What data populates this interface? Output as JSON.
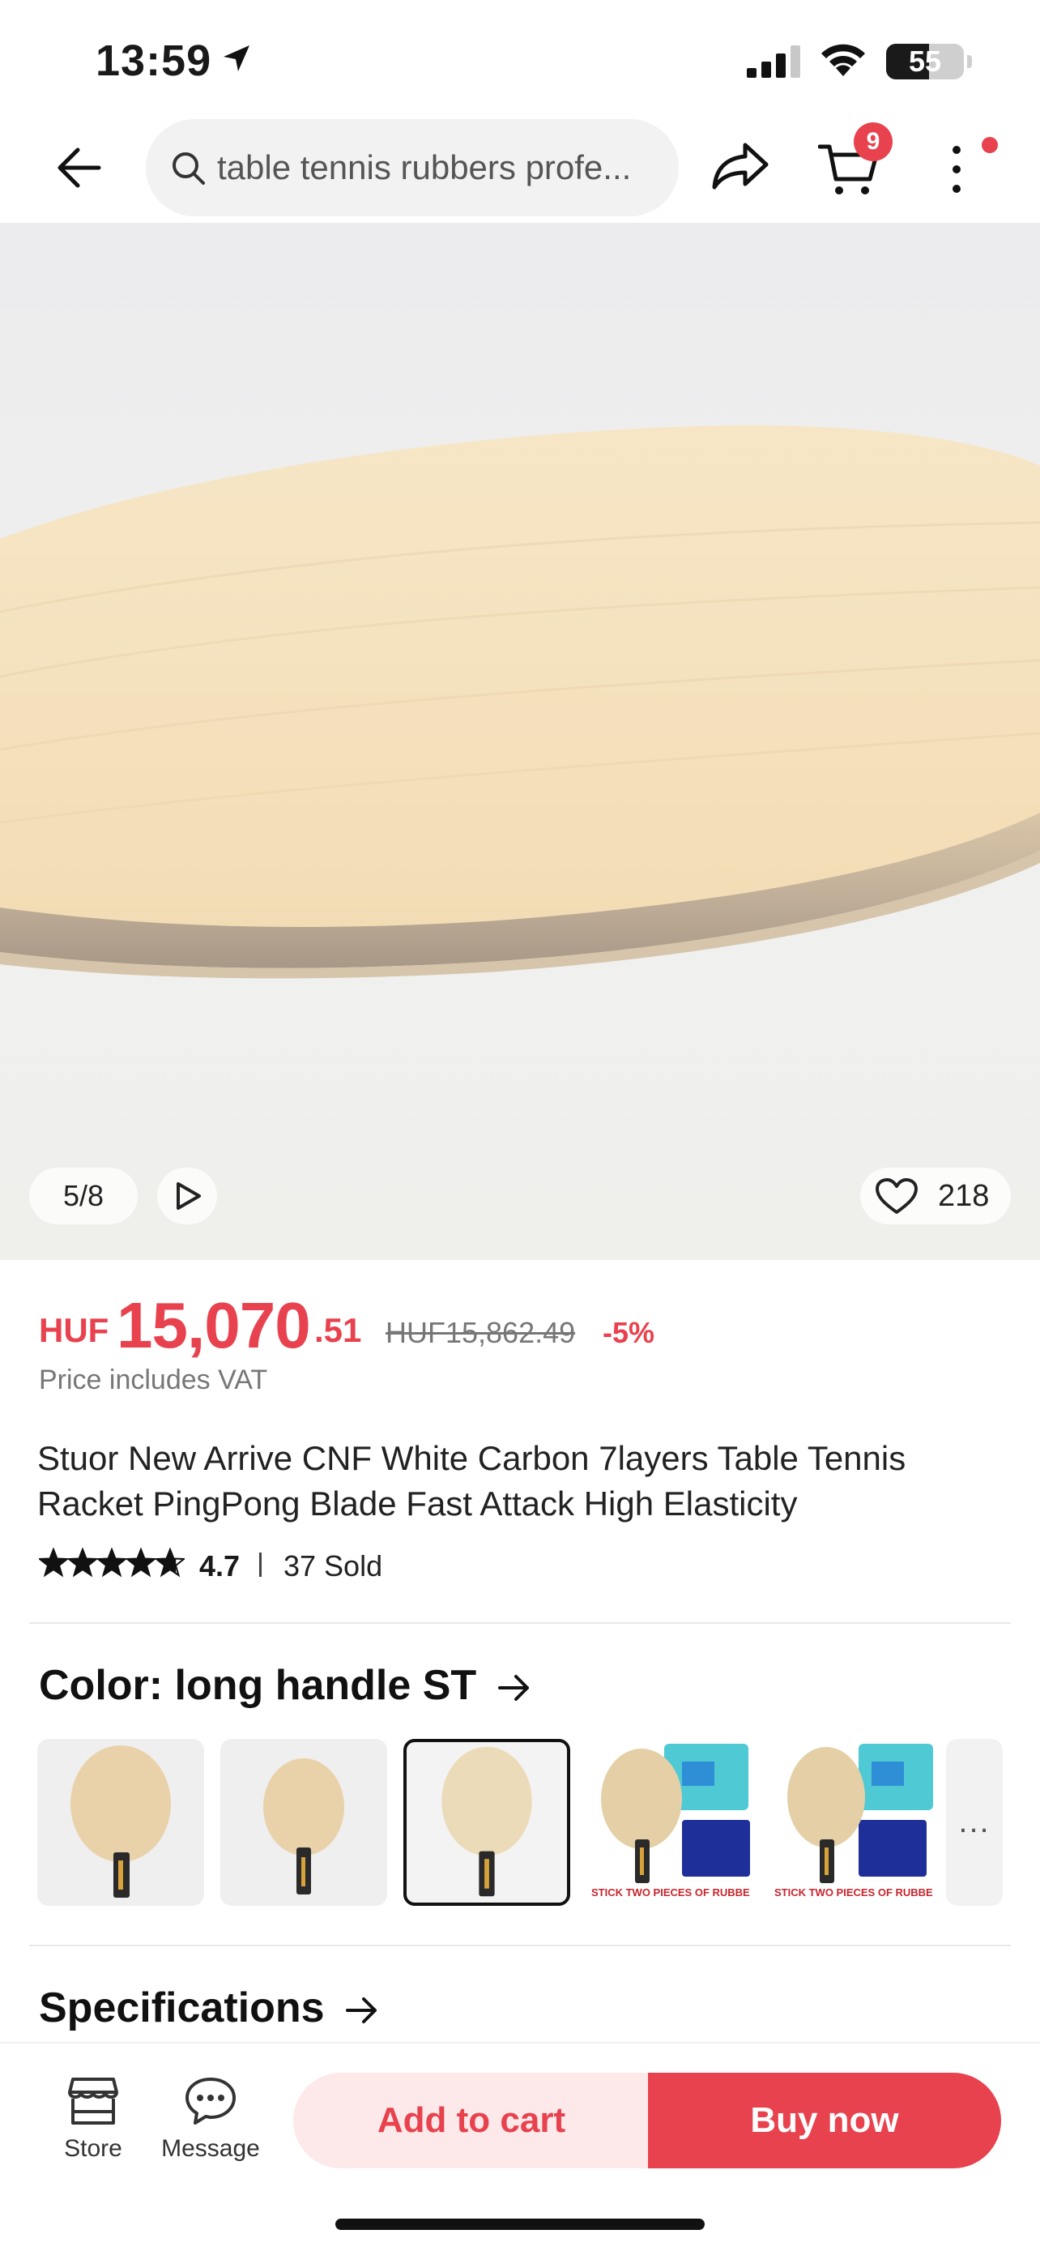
{
  "status_bar": {
    "time": "13:59",
    "battery_level": "55",
    "battery_fraction": 0.55
  },
  "nav": {
    "search_text": "table tennis rubbers profe...",
    "cart_count": "9"
  },
  "gallery": {
    "counter": "5/8",
    "wishlist_count": "218"
  },
  "price": {
    "currency": "HUF",
    "amount_main": "15,070",
    "amount_decimal": ".51",
    "original": "HUF15,862.49",
    "discount": "-5%",
    "vat_note": "Price includes VAT"
  },
  "product": {
    "title": "Stuor New Arrive CNF White Carbon 7layers  Table Tennis Racket PingPong Blade Fast Attack High Elasticity",
    "rating": "4.7",
    "rating_fraction": 0.94,
    "sold": "37 Sold"
  },
  "color_section": {
    "heading": "Color: long handle ST",
    "variants": [
      {
        "name": "variant-1",
        "selected": false
      },
      {
        "name": "variant-2",
        "selected": false
      },
      {
        "name": "variant-3",
        "selected": true
      },
      {
        "name": "variant-4",
        "selected": false,
        "label": "STICK TWO PIECES OF RUBBERS"
      },
      {
        "name": "variant-5",
        "selected": false,
        "label": "STICK TWO PIECES OF RUBBER"
      }
    ],
    "more_label": "..."
  },
  "specifications": {
    "heading": "Specifications"
  },
  "bottom_bar": {
    "store_label": "Store",
    "message_label": "Message",
    "add_to_cart": "Add to cart",
    "buy_now": "Buy now"
  },
  "colors": {
    "accent": "#e8424e",
    "accent_light": "#fde9ea"
  },
  "icons": [
    "location-arrow-icon",
    "signal-icon",
    "wifi-icon",
    "back-arrow-icon",
    "search-icon",
    "share-icon",
    "cart-icon",
    "more-vertical-icon",
    "play-icon",
    "heart-icon",
    "star-icon",
    "arrow-right-icon",
    "store-icon",
    "message-icon"
  ]
}
